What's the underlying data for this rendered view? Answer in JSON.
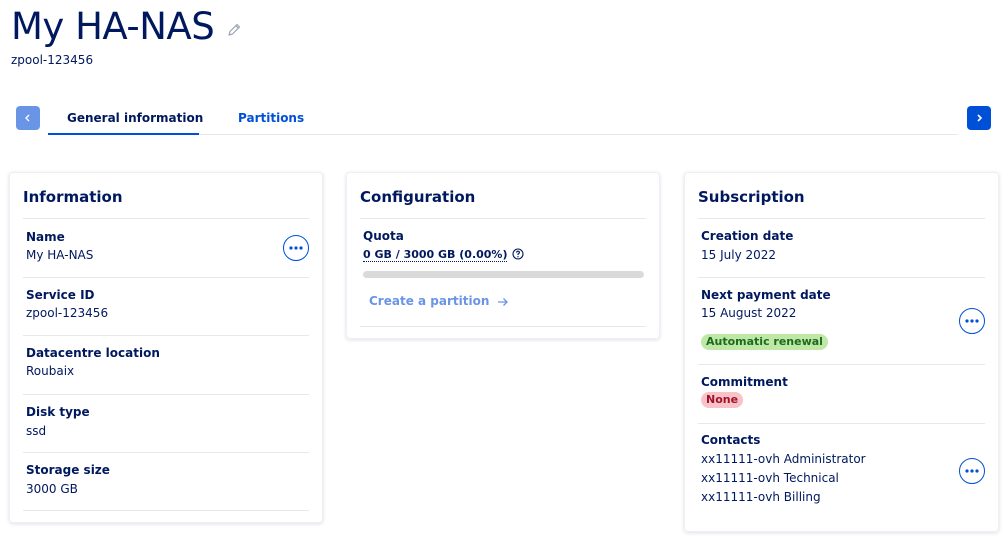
{
  "header": {
    "title": "My HA-NAS",
    "subtitle": "zpool-123456"
  },
  "tabs": [
    {
      "label": "General information",
      "active": true
    },
    {
      "label": "Partitions",
      "active": false
    }
  ],
  "information": {
    "title": "Information",
    "rows": [
      {
        "label": "Name",
        "value": "My HA-NAS"
      },
      {
        "label": "Service ID",
        "value": "zpool-123456"
      },
      {
        "label": "Datacentre location",
        "value": "Roubaix"
      },
      {
        "label": "Disk type",
        "value": "ssd"
      },
      {
        "label": "Storage size",
        "value": "3000 GB"
      }
    ]
  },
  "configuration": {
    "title": "Configuration",
    "quota_label": "Quota",
    "quota_value": "0 GB / 3000 GB (0.00%)",
    "quota_fraction": 0.0,
    "create_link": "Create a partition"
  },
  "subscription": {
    "title": "Subscription",
    "creation_label": "Creation date",
    "creation_value": "15 July 2022",
    "payment_label": "Next payment date",
    "payment_value": "15 August 2022",
    "renewal_badge": "Automatic renewal",
    "commitment_label": "Commitment",
    "commitment_badge": "None",
    "contacts_label": "Contacts",
    "contacts": [
      "xx11111-ovh Administrator",
      "xx11111-ovh Technical",
      "xx11111-ovh Billing"
    ]
  },
  "colors": {
    "primary": "#0050d7",
    "text_dark": "#00185e",
    "badge_success": "#bfe8a8",
    "badge_error": "#f7c3c8"
  },
  "icons": {
    "edit": "pencil-icon",
    "tab_prev": "chevron-left-icon",
    "tab_next": "chevron-right-icon",
    "more": "ellipsis-icon",
    "help": "question-circle-icon",
    "link_arrow": "arrow-right-icon"
  }
}
